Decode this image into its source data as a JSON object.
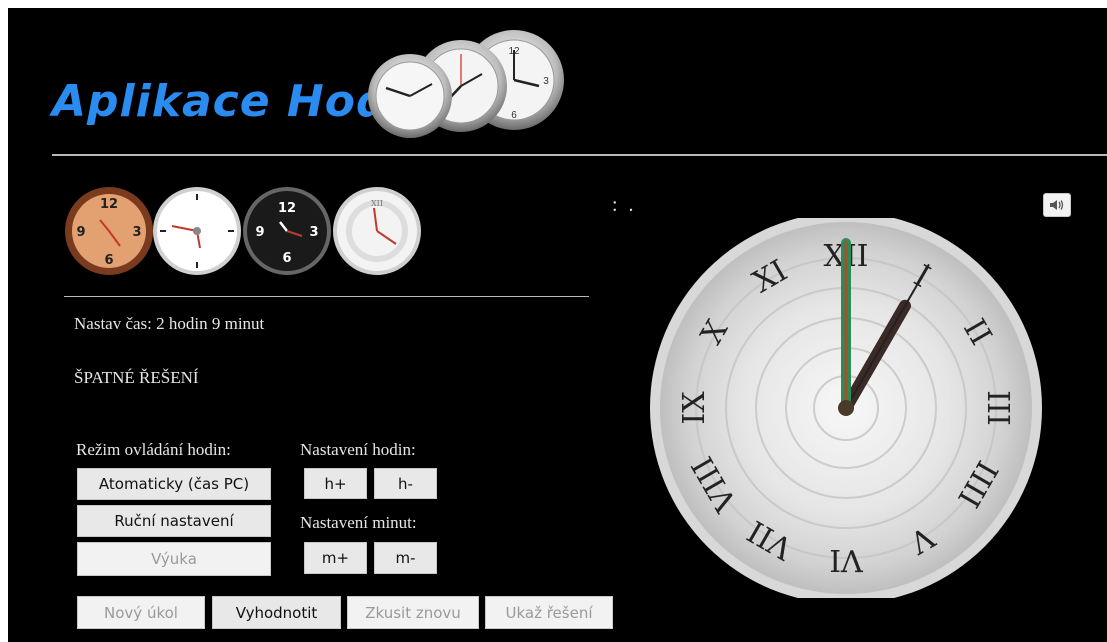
{
  "header": {
    "title": "Aplikace Hodiny"
  },
  "task": {
    "instruction": "Nastav čas: 2 hodin 9 minut",
    "result": "ŠPATNÉ ŘEŠENÍ"
  },
  "controls": {
    "mode_label": "Režim ovládání hodin:",
    "mode_buttons": {
      "auto": "Atomaticky (čas PC)",
      "manual": "Ruční nastavení",
      "learn": "Výuka"
    },
    "hours_label": "Nastavení hodin:",
    "hour_plus": "h+",
    "hour_minus": "h-",
    "minutes_label": "Nastavení minut:",
    "minute_plus": "m+",
    "minute_minus": "m-"
  },
  "actions": {
    "new_task": "Nový úkol",
    "evaluate": "Vyhodnotit",
    "try_again": "Zkusit znovu",
    "show_solution": "Ukaž řešení"
  },
  "digital_time": ": .",
  "clock": {
    "hour": 1,
    "minute": 0,
    "numerals": [
      "XII",
      "I",
      "II",
      "III",
      "IIII",
      "V",
      "VI",
      "VII",
      "VIII",
      "IX",
      "X",
      "XI"
    ]
  },
  "clock_styles": [
    "wooden-clock-icon",
    "white-clock-icon",
    "black-clock-icon",
    "roman-clock-icon"
  ],
  "icons": {
    "sound": "speaker-icon"
  },
  "colors": {
    "title": "#2a8cf0",
    "background": "#000000",
    "second_hand": "#2e8b57"
  }
}
